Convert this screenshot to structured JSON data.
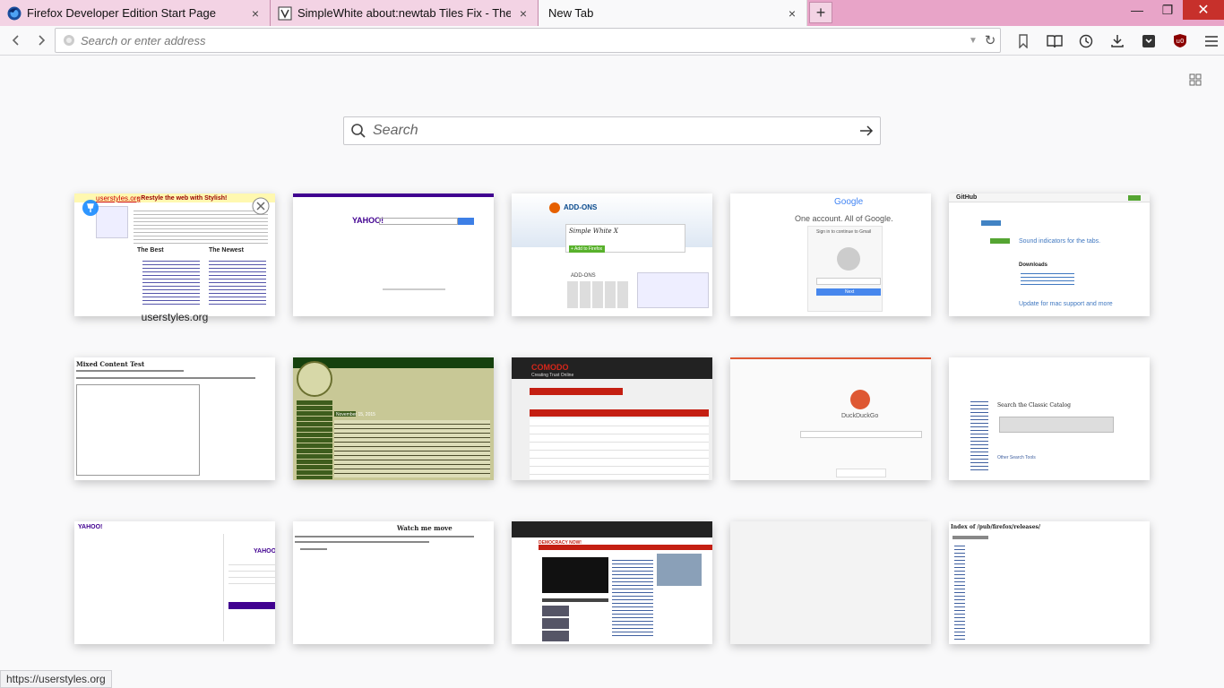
{
  "tabs": [
    {
      "title": "Firefox Developer Edition Start Page",
      "close_icon": "×",
      "state": "inactive",
      "icon": "firefox-dev-icon"
    },
    {
      "title": "SimpleWhite about:newtab Tiles Fix - Themes ...",
      "close_icon": "×",
      "state": "inactive",
      "icon": "userstyles-favicon"
    },
    {
      "title": "New Tab",
      "close_icon": "×",
      "state": "active"
    }
  ],
  "newtab_button": "+",
  "window_controls": {
    "minimize": "—",
    "restore": "❐",
    "close": "✕"
  },
  "urlbar": {
    "placeholder": "Search or enter address"
  },
  "search": {
    "placeholder": "Search"
  },
  "colors": {
    "tabstrip": "#e8a4c8",
    "accent": "#0a84ff",
    "yahoo": "#400090"
  },
  "tiles": [
    {
      "label": "userstyles.org",
      "thumb": "userstyles",
      "text": [
        "userstyles.org",
        "- Restyle the web with Stylish!",
        "The Best",
        "The Newest"
      ]
    },
    {
      "label": "",
      "thumb": "yahoo-search",
      "text": [
        "YAHOO!"
      ]
    },
    {
      "label": "",
      "thumb": "addons",
      "text": [
        "ADD-ONS",
        "Simple White X",
        "+ Add to Firefox",
        "ADD-ONS"
      ]
    },
    {
      "label": "",
      "thumb": "google-signin",
      "text": [
        "Google",
        "One account. All of Google.",
        "Sign in to continue to Gmail",
        "Next"
      ]
    },
    {
      "label": "",
      "thumb": "github",
      "text": [
        "GitHub",
        "Sound indicators for the tabs.",
        "Downloads",
        "Update for mac support and more"
      ]
    },
    {
      "label": "",
      "thumb": "mixed-content",
      "text": [
        "Mixed Content Test"
      ]
    },
    {
      "label": "",
      "thumb": "green-forum",
      "text": [
        "November 15, 2015"
      ]
    },
    {
      "label": "",
      "thumb": "comodo",
      "text": [
        "COMODO",
        "Creating Trust Online"
      ]
    },
    {
      "label": "",
      "thumb": "duckduckgo",
      "text": [
        "DuckDuckGo"
      ]
    },
    {
      "label": "",
      "thumb": "catalog",
      "text": [
        "Search the Classic Catalog",
        "Other Search Tools"
      ]
    },
    {
      "label": "",
      "thumb": "yahoo-signin",
      "text": [
        "YAHOO!",
        "YAHOO!"
      ]
    },
    {
      "label": "",
      "thumb": "watch-me-move",
      "text": [
        "Watch me move"
      ]
    },
    {
      "label": "",
      "thumb": "democracy-now",
      "text": [
        "DEMOCRACY NOW!"
      ]
    },
    {
      "label": "",
      "thumb": "blank",
      "text": []
    },
    {
      "label": "",
      "thumb": "ftp-index",
      "text": [
        "Index of /pub/firefox/releases/"
      ]
    }
  ],
  "status_bar": "https://userstyles.org"
}
